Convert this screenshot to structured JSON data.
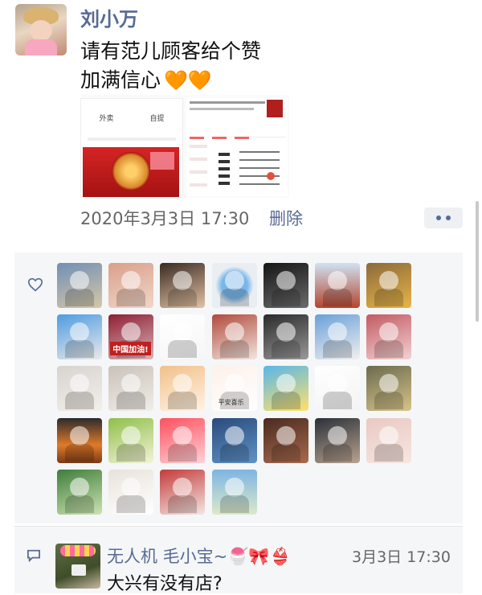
{
  "post": {
    "author": "刘小万",
    "text_lines": [
      "请有范儿顾客给个赞",
      "加满信心"
    ],
    "hearts": "🧡🧡",
    "timestamp": "2020年3月3日 17:30",
    "delete_label": "删除",
    "more_icon": "more-dots-icon"
  },
  "shared_images": [
    {
      "name": "shared-screenshot-1",
      "tab_left": "外卖",
      "tab_right": "自提"
    },
    {
      "name": "shared-screenshot-2"
    }
  ],
  "likes": {
    "icon": "heart-outline-icon",
    "users": [
      {
        "id": "liker-1"
      },
      {
        "id": "liker-2"
      },
      {
        "id": "liker-3"
      },
      {
        "id": "liker-4"
      },
      {
        "id": "liker-5"
      },
      {
        "id": "liker-6"
      },
      {
        "id": "liker-7"
      },
      {
        "id": "liker-8"
      },
      {
        "id": "liker-9",
        "caption": "中国加油!"
      },
      {
        "id": "liker-10"
      },
      {
        "id": "liker-11"
      },
      {
        "id": "liker-12"
      },
      {
        "id": "liker-13"
      },
      {
        "id": "liker-14"
      },
      {
        "id": "liker-15"
      },
      {
        "id": "liker-16"
      },
      {
        "id": "liker-17"
      },
      {
        "id": "liker-18",
        "caption": "平安喜乐"
      },
      {
        "id": "liker-19"
      },
      {
        "id": "liker-20"
      },
      {
        "id": "liker-21"
      },
      {
        "id": "liker-22"
      },
      {
        "id": "liker-23"
      },
      {
        "id": "liker-24"
      },
      {
        "id": "liker-25"
      },
      {
        "id": "liker-26"
      },
      {
        "id": "liker-27"
      },
      {
        "id": "liker-28"
      },
      {
        "id": "liker-29"
      },
      {
        "id": "liker-30"
      },
      {
        "id": "liker-31"
      },
      {
        "id": "liker-32"
      }
    ]
  },
  "comment": {
    "icon": "comment-bubble-icon",
    "author": "无人机 毛小宝~",
    "author_emoji": "🍧🎀👙",
    "time": "3月3日 17:30",
    "text": "大兴有没有店?"
  },
  "colors": {
    "link": "#576b95",
    "text": "#111111",
    "meta": "#666666",
    "panel": "#f5f6f7",
    "heart": "#f26b2e"
  }
}
